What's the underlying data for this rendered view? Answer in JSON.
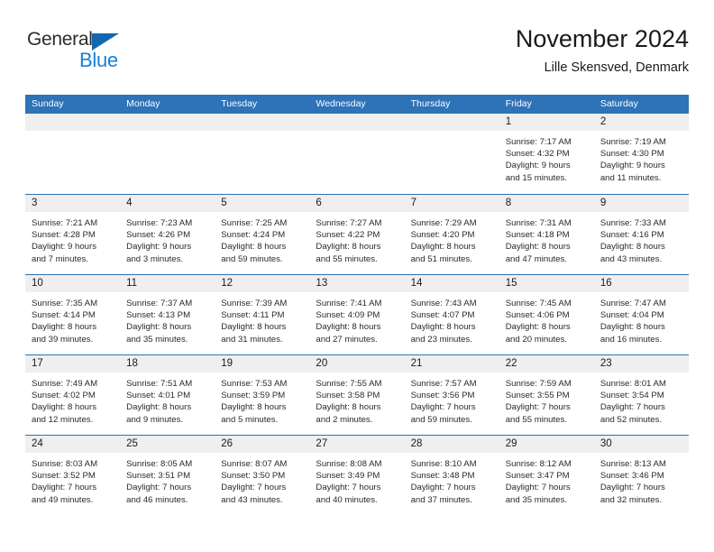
{
  "brand": {
    "name_part1": "General",
    "name_part2": "Blue",
    "triangle_icon": "brand-triangle-icon",
    "colors": {
      "general_text": "#2b2b2b",
      "blue_text": "#1a7fd4",
      "triangle": "#1367b0"
    }
  },
  "header": {
    "title": "November 2024",
    "subtitle": "Lille Skensved, Denmark"
  },
  "theme": {
    "header_blue": "#2e72b8",
    "daynum_band": "#efefef",
    "divider_blue": "#2e72b8"
  },
  "weekday_headers": [
    "Sunday",
    "Monday",
    "Tuesday",
    "Wednesday",
    "Thursday",
    "Friday",
    "Saturday"
  ],
  "weeks": [
    [
      {
        "day": "",
        "lines": []
      },
      {
        "day": "",
        "lines": []
      },
      {
        "day": "",
        "lines": []
      },
      {
        "day": "",
        "lines": []
      },
      {
        "day": "",
        "lines": []
      },
      {
        "day": "1",
        "lines": [
          "Sunrise: 7:17 AM",
          "Sunset: 4:32 PM",
          "Daylight: 9 hours",
          "and 15 minutes."
        ]
      },
      {
        "day": "2",
        "lines": [
          "Sunrise: 7:19 AM",
          "Sunset: 4:30 PM",
          "Daylight: 9 hours",
          "and 11 minutes."
        ]
      }
    ],
    [
      {
        "day": "3",
        "lines": [
          "Sunrise: 7:21 AM",
          "Sunset: 4:28 PM",
          "Daylight: 9 hours",
          "and 7 minutes."
        ]
      },
      {
        "day": "4",
        "lines": [
          "Sunrise: 7:23 AM",
          "Sunset: 4:26 PM",
          "Daylight: 9 hours",
          "and 3 minutes."
        ]
      },
      {
        "day": "5",
        "lines": [
          "Sunrise: 7:25 AM",
          "Sunset: 4:24 PM",
          "Daylight: 8 hours",
          "and 59 minutes."
        ]
      },
      {
        "day": "6",
        "lines": [
          "Sunrise: 7:27 AM",
          "Sunset: 4:22 PM",
          "Daylight: 8 hours",
          "and 55 minutes."
        ]
      },
      {
        "day": "7",
        "lines": [
          "Sunrise: 7:29 AM",
          "Sunset: 4:20 PM",
          "Daylight: 8 hours",
          "and 51 minutes."
        ]
      },
      {
        "day": "8",
        "lines": [
          "Sunrise: 7:31 AM",
          "Sunset: 4:18 PM",
          "Daylight: 8 hours",
          "and 47 minutes."
        ]
      },
      {
        "day": "9",
        "lines": [
          "Sunrise: 7:33 AM",
          "Sunset: 4:16 PM",
          "Daylight: 8 hours",
          "and 43 minutes."
        ]
      }
    ],
    [
      {
        "day": "10",
        "lines": [
          "Sunrise: 7:35 AM",
          "Sunset: 4:14 PM",
          "Daylight: 8 hours",
          "and 39 minutes."
        ]
      },
      {
        "day": "11",
        "lines": [
          "Sunrise: 7:37 AM",
          "Sunset: 4:13 PM",
          "Daylight: 8 hours",
          "and 35 minutes."
        ]
      },
      {
        "day": "12",
        "lines": [
          "Sunrise: 7:39 AM",
          "Sunset: 4:11 PM",
          "Daylight: 8 hours",
          "and 31 minutes."
        ]
      },
      {
        "day": "13",
        "lines": [
          "Sunrise: 7:41 AM",
          "Sunset: 4:09 PM",
          "Daylight: 8 hours",
          "and 27 minutes."
        ]
      },
      {
        "day": "14",
        "lines": [
          "Sunrise: 7:43 AM",
          "Sunset: 4:07 PM",
          "Daylight: 8 hours",
          "and 23 minutes."
        ]
      },
      {
        "day": "15",
        "lines": [
          "Sunrise: 7:45 AM",
          "Sunset: 4:06 PM",
          "Daylight: 8 hours",
          "and 20 minutes."
        ]
      },
      {
        "day": "16",
        "lines": [
          "Sunrise: 7:47 AM",
          "Sunset: 4:04 PM",
          "Daylight: 8 hours",
          "and 16 minutes."
        ]
      }
    ],
    [
      {
        "day": "17",
        "lines": [
          "Sunrise: 7:49 AM",
          "Sunset: 4:02 PM",
          "Daylight: 8 hours",
          "and 12 minutes."
        ]
      },
      {
        "day": "18",
        "lines": [
          "Sunrise: 7:51 AM",
          "Sunset: 4:01 PM",
          "Daylight: 8 hours",
          "and 9 minutes."
        ]
      },
      {
        "day": "19",
        "lines": [
          "Sunrise: 7:53 AM",
          "Sunset: 3:59 PM",
          "Daylight: 8 hours",
          "and 5 minutes."
        ]
      },
      {
        "day": "20",
        "lines": [
          "Sunrise: 7:55 AM",
          "Sunset: 3:58 PM",
          "Daylight: 8 hours",
          "and 2 minutes."
        ]
      },
      {
        "day": "21",
        "lines": [
          "Sunrise: 7:57 AM",
          "Sunset: 3:56 PM",
          "Daylight: 7 hours",
          "and 59 minutes."
        ]
      },
      {
        "day": "22",
        "lines": [
          "Sunrise: 7:59 AM",
          "Sunset: 3:55 PM",
          "Daylight: 7 hours",
          "and 55 minutes."
        ]
      },
      {
        "day": "23",
        "lines": [
          "Sunrise: 8:01 AM",
          "Sunset: 3:54 PM",
          "Daylight: 7 hours",
          "and 52 minutes."
        ]
      }
    ],
    [
      {
        "day": "24",
        "lines": [
          "Sunrise: 8:03 AM",
          "Sunset: 3:52 PM",
          "Daylight: 7 hours",
          "and 49 minutes."
        ]
      },
      {
        "day": "25",
        "lines": [
          "Sunrise: 8:05 AM",
          "Sunset: 3:51 PM",
          "Daylight: 7 hours",
          "and 46 minutes."
        ]
      },
      {
        "day": "26",
        "lines": [
          "Sunrise: 8:07 AM",
          "Sunset: 3:50 PM",
          "Daylight: 7 hours",
          "and 43 minutes."
        ]
      },
      {
        "day": "27",
        "lines": [
          "Sunrise: 8:08 AM",
          "Sunset: 3:49 PM",
          "Daylight: 7 hours",
          "and 40 minutes."
        ]
      },
      {
        "day": "28",
        "lines": [
          "Sunrise: 8:10 AM",
          "Sunset: 3:48 PM",
          "Daylight: 7 hours",
          "and 37 minutes."
        ]
      },
      {
        "day": "29",
        "lines": [
          "Sunrise: 8:12 AM",
          "Sunset: 3:47 PM",
          "Daylight: 7 hours",
          "and 35 minutes."
        ]
      },
      {
        "day": "30",
        "lines": [
          "Sunrise: 8:13 AM",
          "Sunset: 3:46 PM",
          "Daylight: 7 hours",
          "and 32 minutes."
        ]
      }
    ]
  ]
}
